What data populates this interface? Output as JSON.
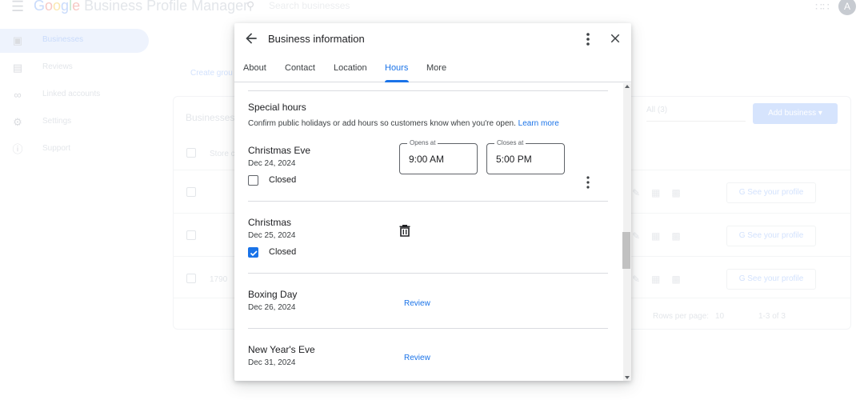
{
  "app": {
    "brand_google": [
      "G",
      "o",
      "o",
      "g",
      "l",
      "e"
    ],
    "brand_rest": " Business Profile Manager",
    "search_placeholder": "Search businesses",
    "avatar_letter": "A"
  },
  "sidebar": {
    "items": [
      {
        "label": "Businesses",
        "icon": "store-icon"
      },
      {
        "label": "Reviews",
        "icon": "reviews-icon"
      },
      {
        "label": "Linked accounts",
        "icon": "link-icon"
      },
      {
        "label": "Settings",
        "icon": "gear-icon"
      },
      {
        "label": "Support",
        "icon": "help-icon"
      }
    ]
  },
  "background": {
    "create_group": "Create grou",
    "businesses_heading": "Businesses",
    "store_col": "Store c",
    "filter_value": "All (3)",
    "add_business": "Add business",
    "row3_code": "1790",
    "see_profile": "See your profile",
    "rows_per_page_label": "Rows per page:",
    "rows_per_page_value": "10",
    "pagination": "1-3 of 3"
  },
  "modal": {
    "title": "Business information",
    "tabs": [
      "About",
      "Contact",
      "Location",
      "Hours",
      "More"
    ],
    "active_tab": "Hours",
    "special_hours": {
      "title": "Special hours",
      "description": "Confirm public holidays or add hours so customers know when you're open.",
      "learn_more": "Learn more",
      "closed_label": "Closed",
      "opens_label": "Opens at",
      "closes_label": "Closes at",
      "review_label": "Review",
      "days": [
        {
          "name": "Christmas Eve",
          "date": "Dec 24, 2024",
          "closed": false,
          "opens": "9:00 AM",
          "closes": "5:00 PM"
        },
        {
          "name": "Christmas",
          "date": "Dec 25, 2024",
          "closed": true
        },
        {
          "name": "Boxing Day",
          "date": "Dec 26, 2024",
          "needs_review": true
        },
        {
          "name": "New Year's Eve",
          "date": "Dec 31, 2024",
          "needs_review": true
        }
      ]
    }
  },
  "colors": {
    "accent": "#1a73e8",
    "text_primary": "#202124",
    "text_secondary": "#3c4043",
    "divider": "#dadce0"
  }
}
